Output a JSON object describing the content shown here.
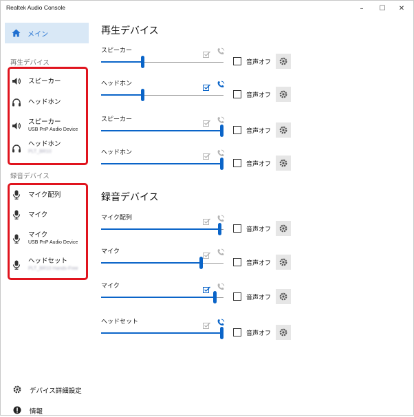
{
  "window": {
    "title": "Realtek Audio Console",
    "controls": {
      "minimize": "–",
      "maximize": "☐",
      "close": "✕"
    }
  },
  "sidebar": {
    "main_label": "メイン",
    "playback_section": "再生デバイス",
    "playback_items": [
      {
        "name": "スピーカー",
        "sub": "",
        "icon": "speaker-icon"
      },
      {
        "name": "ヘッドホン",
        "sub": "",
        "icon": "headphones-icon"
      },
      {
        "name": "スピーカー",
        "sub": "USB PnP Audio Device",
        "icon": "speaker-icon"
      },
      {
        "name": "ヘッドホン",
        "sub": "PLT_BR10",
        "icon": "headphones-icon"
      }
    ],
    "recording_section": "録音デバイス",
    "recording_items": [
      {
        "name": "マイク配列",
        "sub": "",
        "icon": "microphone-icon"
      },
      {
        "name": "マイク",
        "sub": "",
        "icon": "microphone-icon"
      },
      {
        "name": "マイク",
        "sub": "USB PnP Audio Device",
        "icon": "microphone-icon"
      },
      {
        "name": "ヘッドセット",
        "sub": "PLT_BR10 Hands-Free",
        "icon": "microphone-icon"
      }
    ],
    "advanced_settings": "デバイス詳細設定",
    "info": "情報"
  },
  "main": {
    "playback_heading": "再生デバイス",
    "recording_heading": "録音デバイス",
    "mute_label": "音声オフ",
    "playback_devices": [
      {
        "name": "スピーカー",
        "volume": 0.34,
        "default": false,
        "comm_default": false
      },
      {
        "name": "ヘッドホン",
        "volume": 0.34,
        "default": true,
        "comm_default": true
      },
      {
        "name": "スピーカー",
        "volume": 1.0,
        "default": false,
        "comm_default": false
      },
      {
        "name": "ヘッドホン",
        "volume": 1.0,
        "default": false,
        "comm_default": false
      }
    ],
    "recording_devices": [
      {
        "name": "マイク配列",
        "volume": 0.97,
        "default": false,
        "comm_default": false
      },
      {
        "name": "マイク",
        "volume": 0.82,
        "default": false,
        "comm_default": false
      },
      {
        "name": "マイク",
        "volume": 0.93,
        "default": true,
        "comm_default": false
      },
      {
        "name": "ヘッドセット",
        "volume": 1.0,
        "default": false,
        "comm_default": true
      }
    ]
  },
  "colors": {
    "accent": "#0a64c8",
    "selected_bg": "#d9e8f6",
    "highlight_box": "#e0141e",
    "icon_inactive": "#b4b4b4"
  }
}
